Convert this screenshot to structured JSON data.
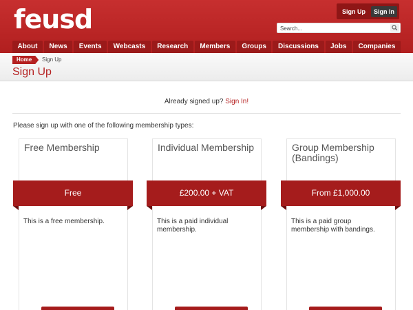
{
  "header": {
    "logo": "feusd",
    "sign_up": "Sign Up",
    "sign_in": "Sign In",
    "search_placeholder": "Search..."
  },
  "nav": [
    "About",
    "News",
    "Events",
    "Webcasts",
    "Research",
    "Members",
    "Groups",
    "Discussions",
    "Jobs",
    "Companies"
  ],
  "breadcrumb": {
    "home": "Home",
    "current": "Sign Up"
  },
  "page_title": "Sign Up",
  "already": {
    "text": "Already signed up?",
    "link": "Sign In!"
  },
  "intro": "Please sign up with one of the following membership types:",
  "cards": [
    {
      "title": "Free Membership",
      "price": "Free",
      "description": "This is a free membership."
    },
    {
      "title": "Individual Membership",
      "price": "£200.00 + VAT",
      "description": "This is a paid individual membership."
    },
    {
      "title": "Group Membership (Bandings)",
      "price": "From £1,000.00",
      "description": "This is a paid group membership with bandings."
    }
  ],
  "colors": {
    "brand": "#b52020",
    "dark": "#8f1616"
  }
}
